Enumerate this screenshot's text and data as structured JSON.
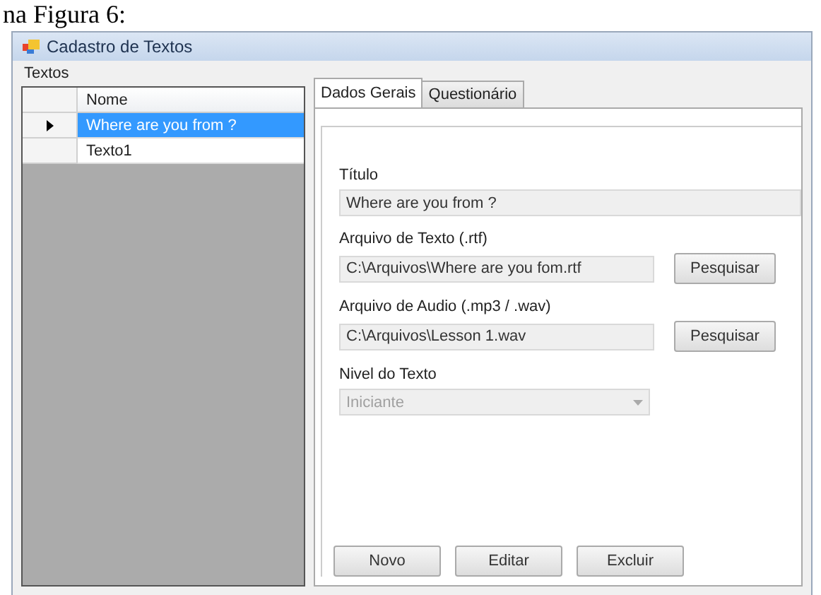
{
  "caption": "na Figura 6:",
  "window": {
    "title": "Cadastro de Textos"
  },
  "group": {
    "title": "Textos"
  },
  "grid": {
    "columns": [
      "Nome"
    ],
    "rows": [
      {
        "cells": [
          "Where are you from ?"
        ],
        "selected": true
      },
      {
        "cells": [
          "Texto1"
        ],
        "selected": false
      }
    ]
  },
  "tabs": [
    {
      "label": "Dados Gerais",
      "selected": true
    },
    {
      "label": "Questionário",
      "selected": false
    }
  ],
  "fields": [
    {
      "kind": "text",
      "label": "Título",
      "value": "Where are you from ?"
    },
    {
      "kind": "file",
      "label": "Arquivo de Texto (.rtf)",
      "value": "C:\\Arquivos\\Where are you fom.rtf",
      "button": "Pesquisar"
    },
    {
      "kind": "file",
      "label": "Arquivo de Audio (.mp3 / .wav)",
      "value": "C:\\Arquivos\\Lesson 1.wav",
      "button": "Pesquisar"
    },
    {
      "kind": "select",
      "label": "Nivel do Texto",
      "value": "Iniciante",
      "disabled": true
    }
  ],
  "buttons": [
    "Novo",
    "Editar",
    "Excluir"
  ]
}
